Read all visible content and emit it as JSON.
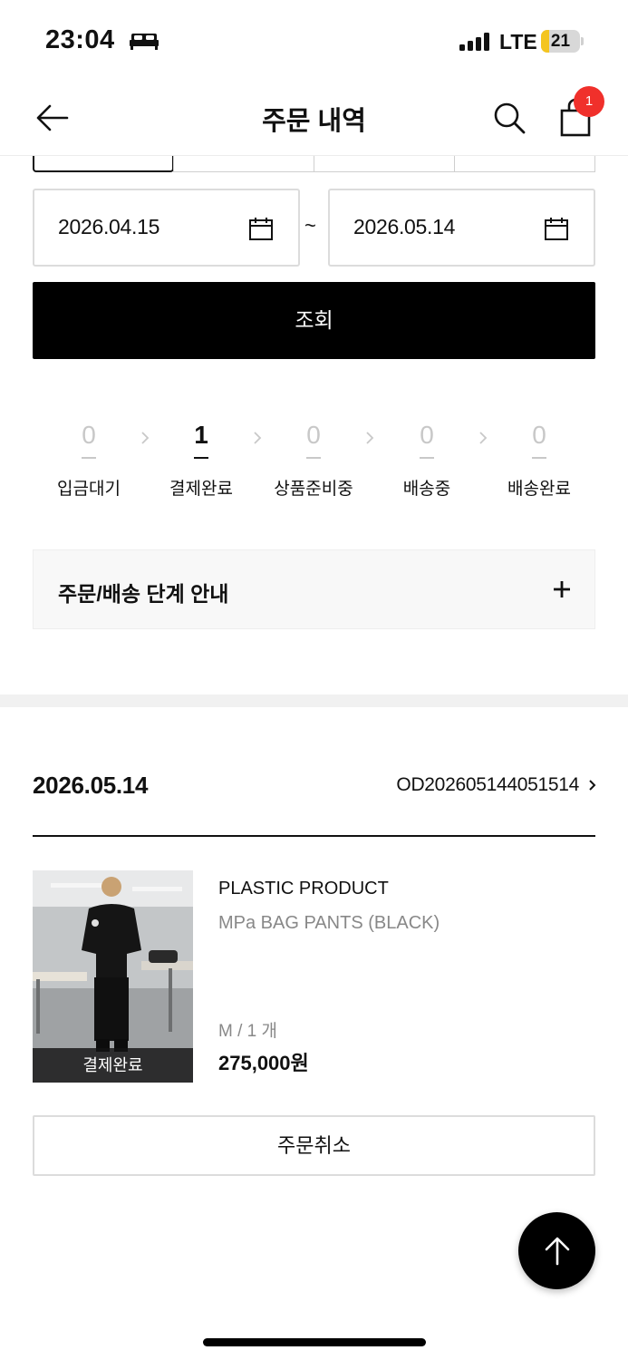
{
  "status_bar": {
    "time": "23:04",
    "network": "LTE",
    "battery": "21",
    "battery_level": 0.21
  },
  "header": {
    "title": "주문 내역",
    "cart_count": "1"
  },
  "date_range": {
    "start": "2026.04.15",
    "separator": "~",
    "end": "2026.05.14",
    "search_label": "조회"
  },
  "steps": [
    {
      "count": "0",
      "label": "입금대기"
    },
    {
      "count": "1",
      "label": "결제완료"
    },
    {
      "count": "0",
      "label": "상품준비중"
    },
    {
      "count": "0",
      "label": "배송중"
    },
    {
      "count": "0",
      "label": "배송완료"
    }
  ],
  "guide": {
    "label": "주문/배송 단계 안내"
  },
  "order": {
    "date": "2026.05.14",
    "number": "OD202605144051514",
    "item": {
      "status": "결제완료",
      "brand": "PLASTIC PRODUCT",
      "name": "MPa BAG PANTS (BLACK)",
      "option": "M / 1 개",
      "price": "275,000원"
    },
    "cancel_label": "주문취소"
  }
}
